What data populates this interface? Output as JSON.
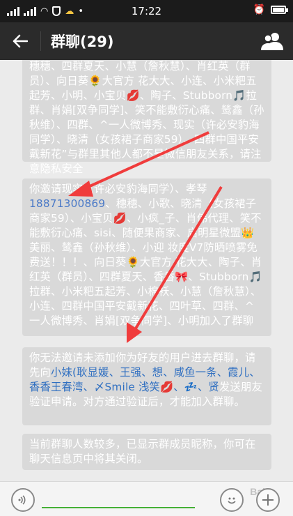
{
  "status": {
    "time": "17:22"
  },
  "header": {
    "title": "群聊(29)",
    "back_icon": "arrow-left-icon",
    "members_icon": "people-icon"
  },
  "messages": [
    {
      "text": "穗穗、四群夏天、小慧（詹秋慧）、肖红英（群员）、向日葵🌻大官方 花大大、小连、小米粑五起芳、小明、小宝贝💋、陶子、Stubborn🎵拉群、肖娟[双争同学]、笑不能敷衍心痛、鸶鑫（孙秋维）、四群、^一人微博秀、现实（许必安豹海同学）、晓清（女孩裙子商家59）、四群中国平安戴新花”与群里其他人都不是微信朋友关系，请注意隐私安全"
    },
    {
      "pre": "你邀请现实（许必安豹海同学）、孝琴",
      "phone": "18871300869",
      "post": "、穗穗、小歌、晓清（女孩裙子商家59）、小宝贝💋、小疯_子、肖伟代理、笑不能敷衍心痛、sisi、随便果商家、启明星微盟👑美丽、鸶鑫（孙秋维）、小迎 妆度V7防晒喷雾免费送！！！、向日葵🌻大官方 花大大、陶子、肖红英（群员）、四群夏天、香香🎀、Stubborn🎵拉群、小米粑五起芳、小棉袄、小慧（詹秋慧）、小连、四群中国平安戴新花、四叶草、四群、^一人微博秀、肖娟[双争同学]、小明加入了群聊"
    },
    {
      "pre": "你无法邀请未添加你为好友的用户进去群聊，请先向",
      "names": "小妹(耿显媛、王强、想、咸鱼一条、霞儿、香香王春湾、〆Smile 浅笑💋、💤、贤",
      "post": "发送朋友验证申请。对方通过验证后，才能加入群聊。"
    },
    {
      "text": "当前群聊人数较多，已显示群成员昵称，你可在聊天信息页中将其关闭。"
    }
  ],
  "input": {
    "voice_icon": "voice-icon",
    "emoji_icon": "emoji-icon",
    "plus_icon": "plus-icon",
    "watermark": "Bai"
  },
  "colors": {
    "header_bg": "#2b2b2b",
    "bubble_bg": "#d9d9d9",
    "link": "#4a79c7",
    "arrow": "#f03c3c",
    "input_accent": "#45b035"
  }
}
